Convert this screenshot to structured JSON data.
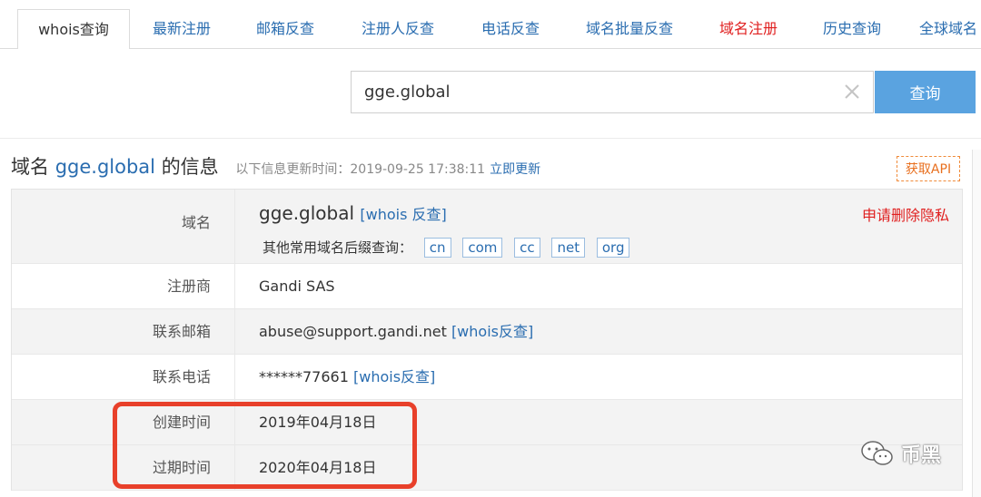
{
  "tabs": [
    {
      "label": "whois查询",
      "active": true
    },
    {
      "label": "最新注册"
    },
    {
      "label": "邮箱反查"
    },
    {
      "label": "注册人反查"
    },
    {
      "label": "电话反查"
    },
    {
      "label": "域名批量反查"
    },
    {
      "label": "域名注册",
      "highlight_color": "#e02020"
    },
    {
      "label": "历史查询"
    },
    {
      "label": "全球域名"
    }
  ],
  "search": {
    "value": "gge.global",
    "button_label": "查询"
  },
  "info": {
    "title_prefix": "域名",
    "domain": "gge.global",
    "title_suffix": "的信息",
    "updated_text": "以下信息更新时间：2019-09-25 17:38:11",
    "update_link": "立即更新",
    "api_button": "获取API"
  },
  "table": {
    "domain_row": {
      "label": "域名",
      "domain": "gge.global",
      "whois_link": "[whois 反查]",
      "suffix_label": "其他常用域名后缀查询：",
      "suffixes": [
        "cn",
        "com",
        "cc",
        "net",
        "org"
      ],
      "privacy_link": "申请删除隐私"
    },
    "registrar": {
      "label": "注册商",
      "value": "Gandi SAS"
    },
    "email": {
      "label": "联系邮箱",
      "value": "abuse@support.gandi.net",
      "link": "[whois反查]"
    },
    "phone": {
      "label": "联系电话",
      "value": "******77661",
      "link": "[whois反查]"
    },
    "created": {
      "label": "创建时间",
      "value": "2019年04月18日"
    },
    "expires": {
      "label": "过期时间",
      "value": "2020年04月18日"
    }
  },
  "watermark": {
    "text": "币黑",
    "icon": "wechat-icon"
  },
  "colors": {
    "link": "#2a6db0",
    "button": "#5aa3e0",
    "red": "#e02020",
    "highlight": "#e8402a",
    "api": "#e86f1e"
  }
}
